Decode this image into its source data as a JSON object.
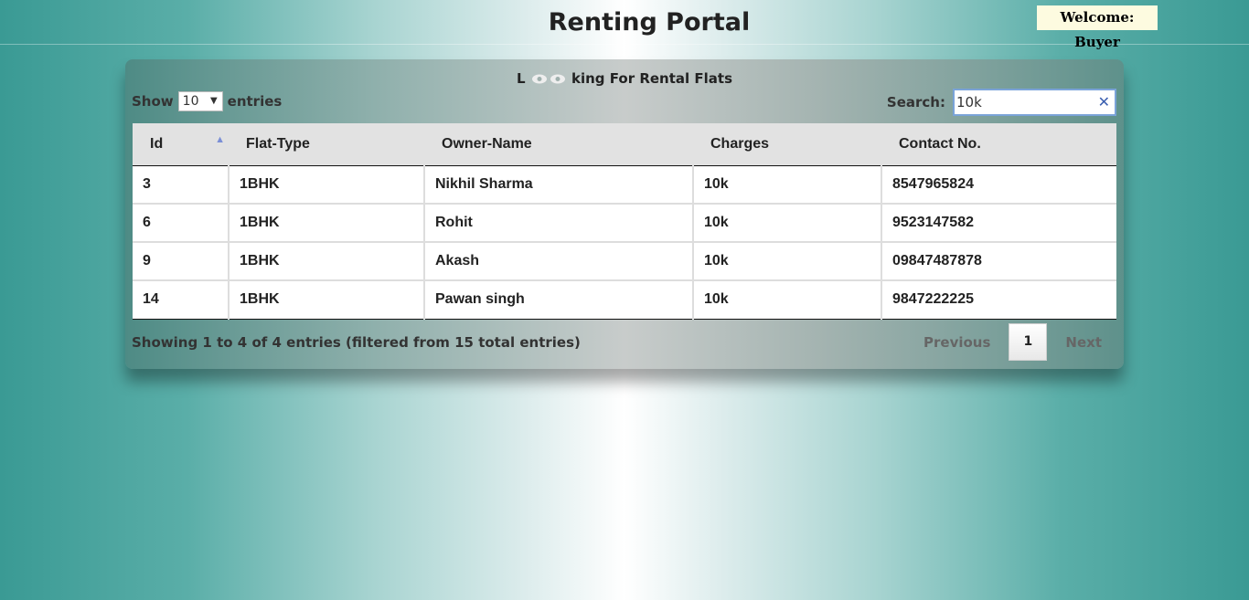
{
  "header": {
    "title": "Renting Portal",
    "welcome": "Welcome: Buyer"
  },
  "panel": {
    "heading_prefix": "L",
    "heading_suffix": "king For Rental Flats",
    "length": {
      "show": "Show",
      "value": "10",
      "entries": "entries"
    },
    "search": {
      "label": "Search:",
      "value": "10k",
      "clear": "✕"
    }
  },
  "table": {
    "columns": [
      "Id",
      "Flat-Type",
      "Owner-Name",
      "Charges",
      "Contact No."
    ],
    "rows": [
      [
        "3",
        "1BHK",
        "Nikhil Sharma",
        "10k",
        "8547965824"
      ],
      [
        "6",
        "1BHK",
        "Rohit",
        "10k",
        "9523147582"
      ],
      [
        "9",
        "1BHK",
        "Akash",
        "10k",
        "09847487878"
      ],
      [
        "14",
        "1BHK",
        "Pawan singh",
        "10k",
        "9847222225"
      ]
    ]
  },
  "footer": {
    "info": "Showing 1 to 4 of 4 entries (filtered from 15 total entries)",
    "previous": "Previous",
    "current_page": "1",
    "next": "Next"
  }
}
